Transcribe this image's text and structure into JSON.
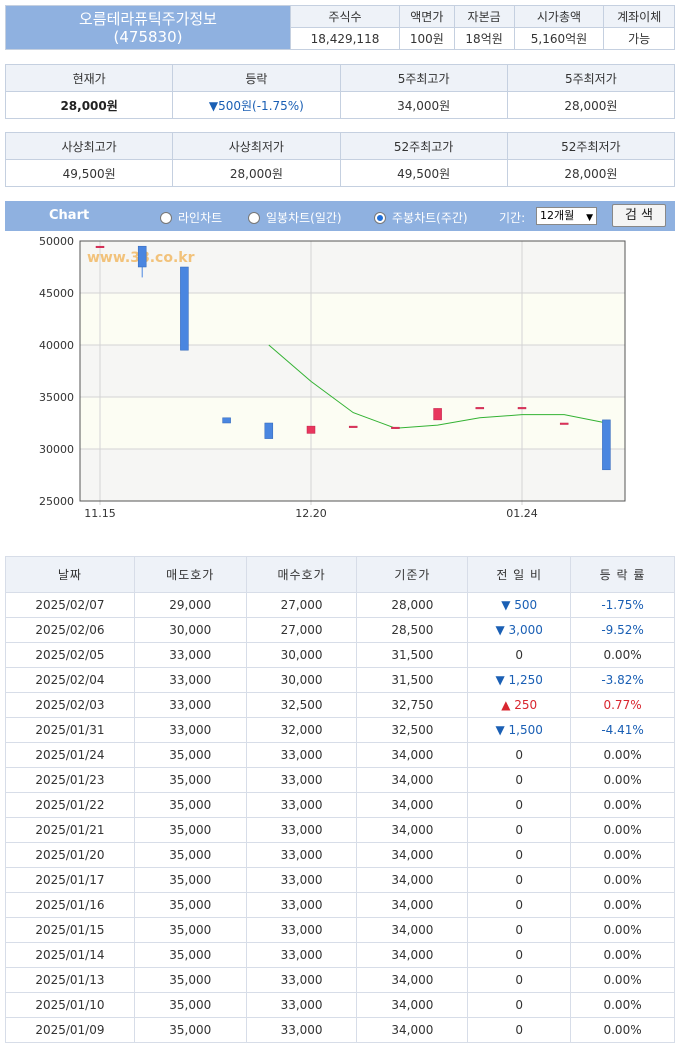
{
  "header": {
    "title": "오름테라퓨틱주가정보",
    "code": "(475830)",
    "columns": [
      "주식수",
      "액면가",
      "자본금",
      "시가총액",
      "계좌이체"
    ],
    "values": [
      "18,429,118",
      "100원",
      "18억원",
      "5,160억원",
      "가능"
    ]
  },
  "price": {
    "labels": [
      "현재가",
      "등락",
      "5주최고가",
      "5주최저가"
    ],
    "current": "28,000원",
    "change": "▼500원(-1.75%)",
    "high5w": "34,000원",
    "low5w": "28,000원"
  },
  "range": {
    "labels": [
      "사상최고가",
      "사상최저가",
      "52주최고가",
      "52주최저가"
    ],
    "values": [
      "49,500원",
      "28,000원",
      "49,500원",
      "28,000원"
    ]
  },
  "chart_controls": {
    "title": "Chart",
    "options": [
      "라인차트",
      "일봉차트(일간)",
      "주봉차트(주간)"
    ],
    "selected": 2,
    "period_label": "기간:",
    "period_value": "12개월",
    "search_label": "검 색"
  },
  "watermark": "www.38.co.kr",
  "colors": {
    "accent": "#8fb1e0",
    "up": "#e8365d",
    "down": "#4a86e0",
    "ma": "#33b233"
  },
  "chart_data": {
    "type": "candlestick",
    "ylim": [
      25000,
      50000
    ],
    "yticks": [
      50000,
      45000,
      40000,
      35000,
      30000,
      25000
    ],
    "xticks": [
      "11.15",
      "12.20",
      "01.24"
    ],
    "candles": [
      {
        "x": 0,
        "open": 49500,
        "close": 49500,
        "high": 49500,
        "low": 49500
      },
      {
        "x": 1,
        "open": 49500,
        "close": 47500,
        "high": 49500,
        "low": 46500
      },
      {
        "x": 2,
        "open": 47500,
        "close": 39500,
        "high": 47500,
        "low": 39500
      },
      {
        "x": 3,
        "open": 33000,
        "close": 32500,
        "high": 33000,
        "low": 32500
      },
      {
        "x": 4,
        "open": 32500,
        "close": 31000,
        "high": 32500,
        "low": 31000
      },
      {
        "x": 5,
        "open": 31500,
        "close": 32200,
        "high": 32200,
        "low": 31500
      },
      {
        "x": 6,
        "open": 32200,
        "close": 32200,
        "high": 32200,
        "low": 32200
      },
      {
        "x": 7,
        "open": 32100,
        "close": 32100,
        "high": 32100,
        "low": 32100
      },
      {
        "x": 8,
        "open": 32800,
        "close": 33900,
        "high": 33900,
        "low": 32800
      },
      {
        "x": 9,
        "open": 34000,
        "close": 34000,
        "high": 34000,
        "low": 34000
      },
      {
        "x": 10,
        "open": 34000,
        "close": 34000,
        "high": 34000,
        "low": 34000
      },
      {
        "x": 11,
        "open": 32500,
        "close": 32500,
        "high": 32500,
        "low": 32500
      },
      {
        "x": 12,
        "open": 32800,
        "close": 28000,
        "high": 32800,
        "low": 28000
      }
    ],
    "moving_average": [
      {
        "x": 4,
        "y": 40000
      },
      {
        "x": 5,
        "y": 36500
      },
      {
        "x": 6,
        "y": 33500
      },
      {
        "x": 7,
        "y": 32000
      },
      {
        "x": 8,
        "y": 32300
      },
      {
        "x": 9,
        "y": 33000
      },
      {
        "x": 10,
        "y": 33300
      },
      {
        "x": 11,
        "y": 33300
      },
      {
        "x": 12,
        "y": 32500
      }
    ]
  },
  "table": {
    "headers": [
      "날짜",
      "매도호가",
      "매수호가",
      "기준가",
      "전 일 비",
      "등 락 률"
    ],
    "rows": [
      {
        "date": "2025/02/07",
        "sell": "29,000",
        "buy": "27,000",
        "base": "28,000",
        "diff": "▼ 500",
        "rate": "-1.75%",
        "dir": "down"
      },
      {
        "date": "2025/02/06",
        "sell": "30,000",
        "buy": "27,000",
        "base": "28,500",
        "diff": "▼ 3,000",
        "rate": "-9.52%",
        "dir": "down"
      },
      {
        "date": "2025/02/05",
        "sell": "33,000",
        "buy": "30,000",
        "base": "31,500",
        "diff": "0",
        "rate": "0.00%",
        "dir": "flat"
      },
      {
        "date": "2025/02/04",
        "sell": "33,000",
        "buy": "30,000",
        "base": "31,500",
        "diff": "▼ 1,250",
        "rate": "-3.82%",
        "dir": "down"
      },
      {
        "date": "2025/02/03",
        "sell": "33,000",
        "buy": "32,500",
        "base": "32,750",
        "diff": "▲ 250",
        "rate": "0.77%",
        "dir": "up"
      },
      {
        "date": "2025/01/31",
        "sell": "33,000",
        "buy": "32,000",
        "base": "32,500",
        "diff": "▼ 1,500",
        "rate": "-4.41%",
        "dir": "down"
      },
      {
        "date": "2025/01/24",
        "sell": "35,000",
        "buy": "33,000",
        "base": "34,000",
        "diff": "0",
        "rate": "0.00%",
        "dir": "flat"
      },
      {
        "date": "2025/01/23",
        "sell": "35,000",
        "buy": "33,000",
        "base": "34,000",
        "diff": "0",
        "rate": "0.00%",
        "dir": "flat"
      },
      {
        "date": "2025/01/22",
        "sell": "35,000",
        "buy": "33,000",
        "base": "34,000",
        "diff": "0",
        "rate": "0.00%",
        "dir": "flat"
      },
      {
        "date": "2025/01/21",
        "sell": "35,000",
        "buy": "33,000",
        "base": "34,000",
        "diff": "0",
        "rate": "0.00%",
        "dir": "flat"
      },
      {
        "date": "2025/01/20",
        "sell": "35,000",
        "buy": "33,000",
        "base": "34,000",
        "diff": "0",
        "rate": "0.00%",
        "dir": "flat"
      },
      {
        "date": "2025/01/17",
        "sell": "35,000",
        "buy": "33,000",
        "base": "34,000",
        "diff": "0",
        "rate": "0.00%",
        "dir": "flat"
      },
      {
        "date": "2025/01/16",
        "sell": "35,000",
        "buy": "33,000",
        "base": "34,000",
        "diff": "0",
        "rate": "0.00%",
        "dir": "flat"
      },
      {
        "date": "2025/01/15",
        "sell": "35,000",
        "buy": "33,000",
        "base": "34,000",
        "diff": "0",
        "rate": "0.00%",
        "dir": "flat"
      },
      {
        "date": "2025/01/14",
        "sell": "35,000",
        "buy": "33,000",
        "base": "34,000",
        "diff": "0",
        "rate": "0.00%",
        "dir": "flat"
      },
      {
        "date": "2025/01/13",
        "sell": "35,000",
        "buy": "33,000",
        "base": "34,000",
        "diff": "0",
        "rate": "0.00%",
        "dir": "flat"
      },
      {
        "date": "2025/01/10",
        "sell": "35,000",
        "buy": "33,000",
        "base": "34,000",
        "diff": "0",
        "rate": "0.00%",
        "dir": "flat"
      },
      {
        "date": "2025/01/09",
        "sell": "35,000",
        "buy": "33,000",
        "base": "34,000",
        "diff": "0",
        "rate": "0.00%",
        "dir": "flat"
      }
    ]
  }
}
